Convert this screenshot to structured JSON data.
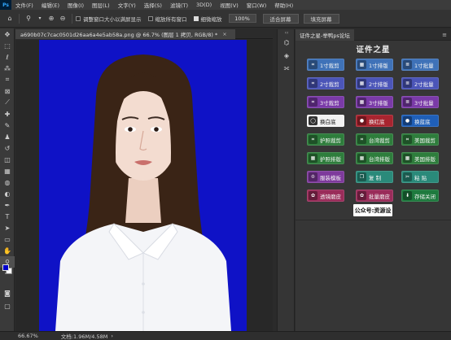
{
  "app": {
    "logo": "Ps"
  },
  "menu": [
    "文件(F)",
    "编辑(E)",
    "图像(I)",
    "图层(L)",
    "文字(Y)",
    "选择(S)",
    "滤镜(T)",
    "3D(D)",
    "视图(V)",
    "窗口(W)",
    "帮助(H)"
  ],
  "options": {
    "home_icon": "home-icon",
    "zoom_icon": "zoom-icon",
    "resize_windows": "调整窗口大小以满屏显示",
    "zoom_all": "缩放所有窗口",
    "scrubby_zoom": "细微缩放",
    "zoom_value": "100%",
    "fit_screen": "适合屏幕",
    "fill_screen": "填充屏幕",
    "checkbox_states": {
      "resize_windows": false,
      "zoom_all": false,
      "scrubby_zoom": true
    }
  },
  "document": {
    "tab_title": "a690b07c7cac0501d26aa6a4e5ab58a.png @ 66.7% (图层 1 拷贝, RGB/8) *",
    "close": "×",
    "background_color": "#0f12c6"
  },
  "status": {
    "zoom": "66.67%",
    "doc_size": "文档:1.96M/4.58M"
  },
  "swatches": {
    "foreground": "#0000cc",
    "background": "#ffffff"
  },
  "plugin_panel": {
    "tab_label": "证件之星-举鸭ps论坛",
    "menu_icon": "≡",
    "title": "证件之星",
    "buttons": [
      {
        "label": "1寸裁剪",
        "color": "#3f72b8",
        "icon": "crop-icon"
      },
      {
        "label": "1寸排版",
        "color": "#3f72b8",
        "icon": "layout-icon"
      },
      {
        "label": "1寸批量",
        "color": "#3f72b8",
        "icon": "batch-icon"
      },
      {
        "label": "2寸裁剪",
        "color": "#4b55b8",
        "icon": "crop-icon"
      },
      {
        "label": "2寸排版",
        "color": "#4b55b8",
        "icon": "layout-icon"
      },
      {
        "label": "2寸批量",
        "color": "#4b55b8",
        "icon": "batch-icon"
      },
      {
        "label": "3寸裁剪",
        "color": "#7a3aa8",
        "icon": "crop-icon"
      },
      {
        "label": "3寸排版",
        "color": "#7a3aa8",
        "icon": "layout-icon"
      },
      {
        "label": "3寸批量",
        "color": "#7a3aa8",
        "icon": "batch-icon"
      },
      {
        "label": "换白底",
        "color": "#f2f2f2",
        "icon": "white-bg-icon",
        "light": true
      },
      {
        "label": "换红底",
        "color": "#a8242f",
        "icon": "red-bg-icon"
      },
      {
        "label": "换蓝底",
        "color": "#1f5fb8",
        "icon": "blue-bg-icon"
      },
      {
        "label": "护照裁剪",
        "color": "#2e7d3c",
        "icon": "crop-icon"
      },
      {
        "label": "台湾裁剪",
        "color": "#2e7d3c",
        "icon": "crop-icon"
      },
      {
        "label": "美国裁剪",
        "color": "#2e7d3c",
        "icon": "crop-icon"
      },
      {
        "label": "护照排版",
        "color": "#2e7d3c",
        "icon": "layout-icon"
      },
      {
        "label": "台湾排版",
        "color": "#2e7d3c",
        "icon": "layout-icon"
      },
      {
        "label": "美国排版",
        "color": "#2e7d3c",
        "icon": "layout-icon"
      },
      {
        "label": "服装模板",
        "color": "#7e3a9c",
        "icon": "clothing-icon"
      },
      {
        "label": "复 制",
        "color": "#2a8a7a",
        "icon": "copy-icon"
      },
      {
        "label": "粘 贴",
        "color": "#2a8a7a",
        "icon": "paste-icon"
      },
      {
        "label": "透镜磨皮",
        "color": "#9a2c5a",
        "icon": "smooth-icon"
      },
      {
        "label": "批量磨皮",
        "color": "#9a2c5a",
        "icon": "smooth-icon"
      },
      {
        "label": "存储关闭",
        "color": "#1e7a3e",
        "icon": "save-icon"
      }
    ],
    "footer_badge": "公众号:资源设"
  }
}
